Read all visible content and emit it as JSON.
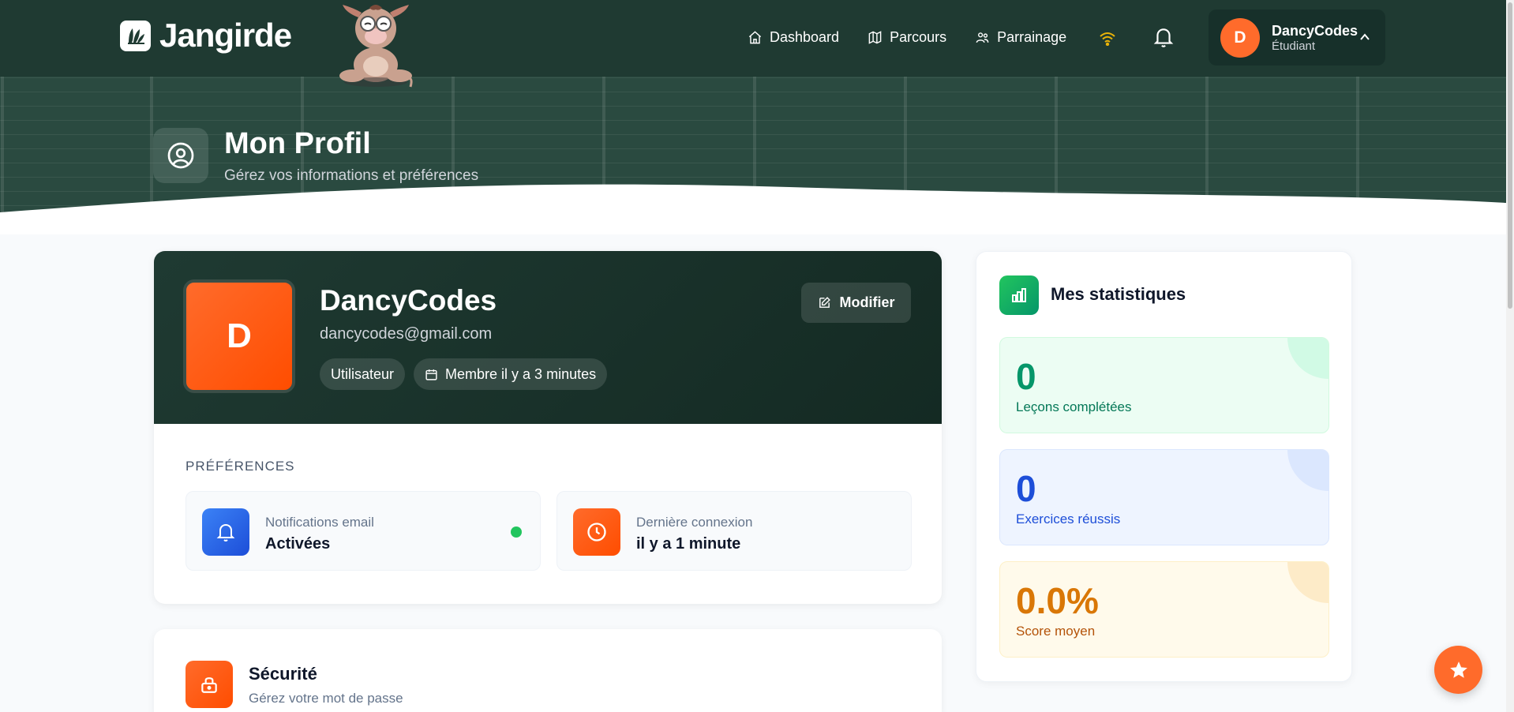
{
  "app": {
    "brand": "Jangirde"
  },
  "nav": {
    "items": [
      {
        "label": "Dashboard",
        "icon": "home-icon"
      },
      {
        "label": "Parcours",
        "icon": "map-icon"
      },
      {
        "label": "Parrainage",
        "icon": "users-icon"
      }
    ],
    "wifi_icon": "wifi-icon",
    "bell_icon": "bell-icon"
  },
  "user": {
    "initial": "D",
    "name": "DancyCodes",
    "role": "Étudiant"
  },
  "hero": {
    "title": "Mon Profil",
    "subtitle": "Gérez vos informations et préférences"
  },
  "profile": {
    "initial": "D",
    "name": "DancyCodes",
    "email": "dancycodes@gmail.com",
    "chip_role": "Utilisateur",
    "chip_member": "Membre il y a 3 minutes",
    "edit_label": "Modifier"
  },
  "preferences": {
    "title": "PRÉFÉRENCES",
    "notifications": {
      "label": "Notifications email",
      "value": "Activées"
    },
    "last_login": {
      "label": "Dernière connexion",
      "value": "il y a 1 minute"
    }
  },
  "security": {
    "title": "Sécurité",
    "subtitle": "Gérez votre mot de passe"
  },
  "stats": {
    "title": "Mes statistiques",
    "items": [
      {
        "value": "0",
        "label": "Leçons complétées"
      },
      {
        "value": "0",
        "label": "Exercices réussis"
      },
      {
        "value": "0.0%",
        "label": "Score moyen"
      }
    ]
  },
  "colors": {
    "accent": "#ff6b2b",
    "header": "#1f3a32",
    "success": "#22c55e"
  }
}
